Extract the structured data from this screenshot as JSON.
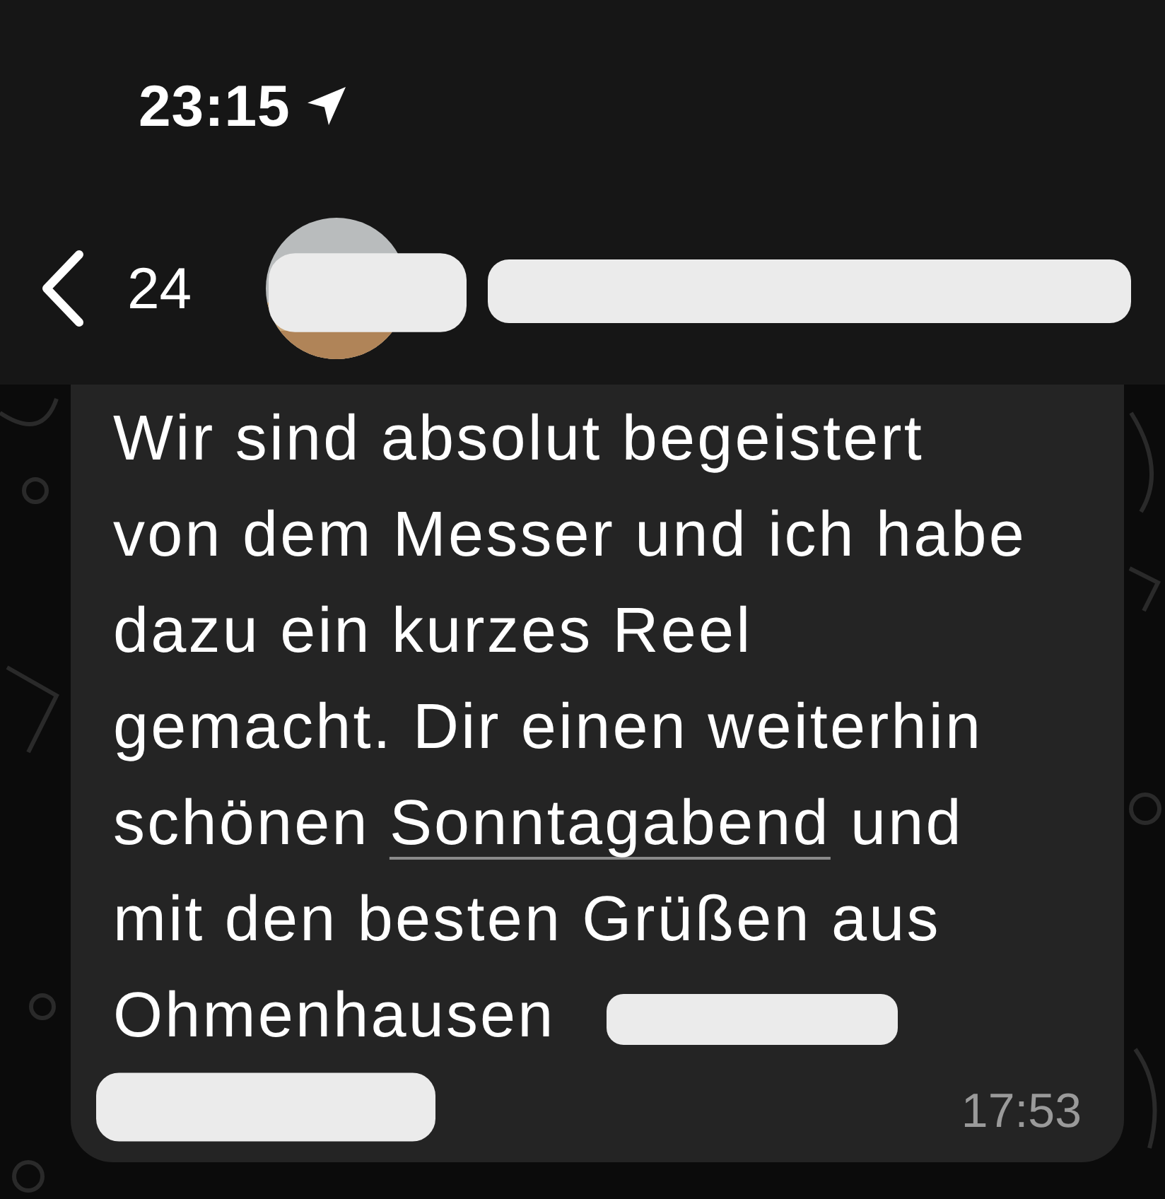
{
  "status_bar": {
    "time": "23:15"
  },
  "header": {
    "back_count": "24"
  },
  "message": {
    "lines": [
      [
        {
          "kind": "plain",
          "text": "Wir sind absolut begeistert"
        }
      ],
      [
        {
          "kind": "plain",
          "text": "von dem Messer und ich habe"
        }
      ],
      [
        {
          "kind": "plain",
          "text": "dazu ein kurzes Reel"
        }
      ],
      [
        {
          "kind": "plain",
          "text": "gemacht. Dir einen weiterhin"
        }
      ],
      [
        {
          "kind": "plain",
          "text": "schönen "
        },
        {
          "kind": "link",
          "text": "Sonntagabend"
        },
        {
          "kind": "plain",
          "text": " und"
        }
      ],
      [
        {
          "kind": "plain",
          "text": "mit den besten Grüßen aus"
        }
      ],
      [
        {
          "kind": "plain",
          "text": "Ohmenhausen"
        }
      ]
    ],
    "time": "17:53"
  }
}
